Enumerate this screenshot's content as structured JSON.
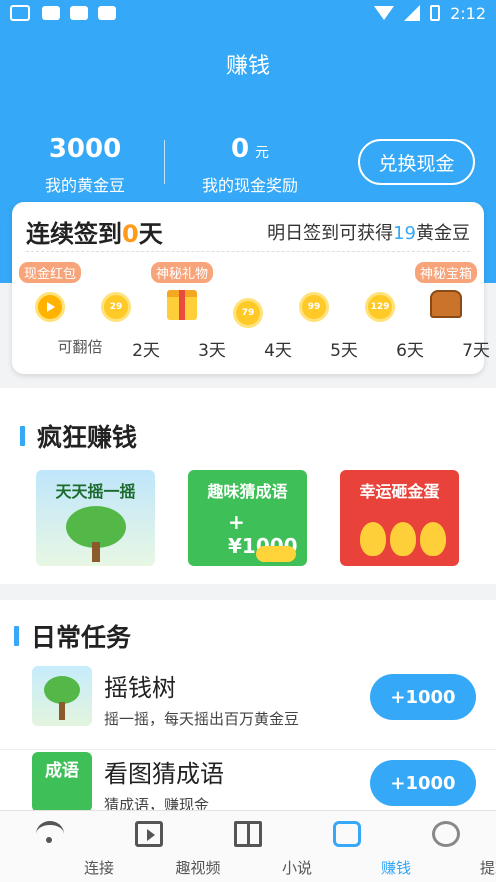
{
  "statusbar": {
    "time": "2:12"
  },
  "header": {
    "title": "赚钱"
  },
  "stats": {
    "gold_value": "3000",
    "gold_label": "我的黄金豆",
    "cash_value": "0",
    "cash_unit": "元",
    "cash_label": "我的现金奖励",
    "exchange_button": "兑换现金"
  },
  "signin": {
    "streak_prefix": "连续签到",
    "streak_days": "0",
    "streak_suffix": "天",
    "tomorrow_prefix": "明日签到可获得",
    "tomorrow_amount": "19",
    "tomorrow_suffix": "黄金豆",
    "days": [
      {
        "tag": "现金红包",
        "label": "可翻倍",
        "coin": ""
      },
      {
        "tag": "",
        "label": "2天",
        "coin": "29"
      },
      {
        "tag": "神秘礼物",
        "label": "3天",
        "coin": ""
      },
      {
        "tag": "",
        "label": "4天",
        "coin": "79"
      },
      {
        "tag": "",
        "label": "5天",
        "coin": "99"
      },
      {
        "tag": "",
        "label": "6天",
        "coin": "129"
      },
      {
        "tag": "神秘宝箱",
        "label": "7天",
        "coin": ""
      }
    ]
  },
  "crazy_earn": {
    "title": "疯狂赚钱",
    "games": [
      {
        "title": "天天摇一摇"
      },
      {
        "title": "趣味猜成语",
        "prize": "+¥1000"
      },
      {
        "title": "幸运砸金蛋"
      }
    ]
  },
  "daily_tasks": {
    "title": "日常任务",
    "tasks": [
      {
        "name": "摇钱树",
        "desc": "摇一摇，每天摇出百万黄金豆",
        "reward": "+1000",
        "thumb_text": ""
      },
      {
        "name": "看图猜成语",
        "desc": "猜成语，赚现金",
        "reward": "+1000",
        "thumb_text": "成语"
      }
    ]
  },
  "bottom_nav": [
    {
      "label": "连接"
    },
    {
      "label": "趣视频"
    },
    {
      "label": "小说"
    },
    {
      "label": "赚钱"
    },
    {
      "label": "提现"
    }
  ]
}
